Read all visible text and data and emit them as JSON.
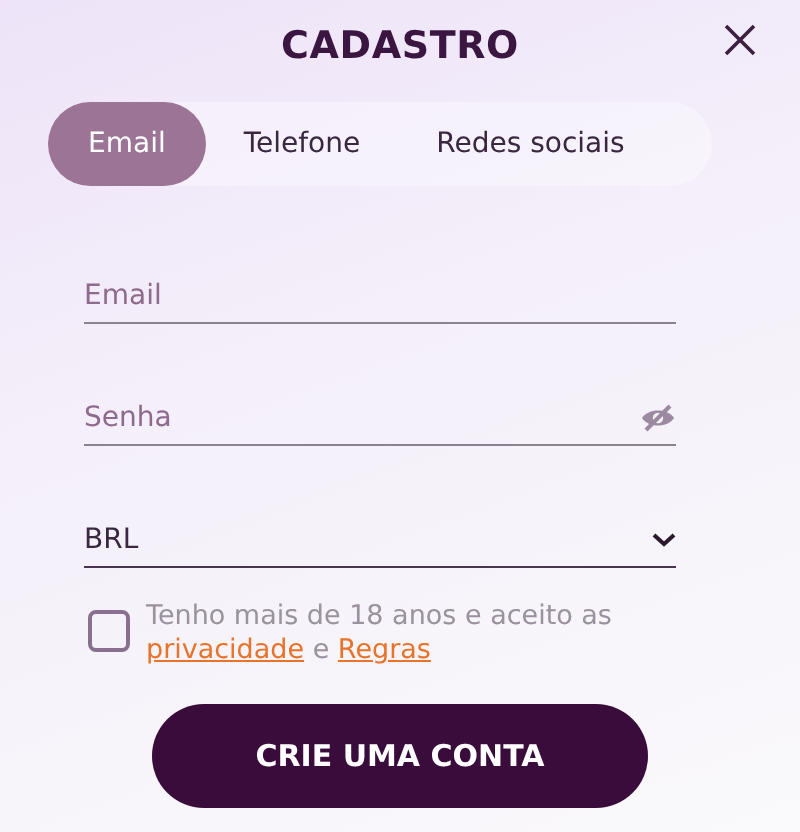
{
  "title": "CADASTRO",
  "tabs": [
    {
      "label": "Email",
      "selected": true
    },
    {
      "label": "Telefone",
      "selected": false
    },
    {
      "label": "Redes sociais",
      "selected": false
    }
  ],
  "fields": [
    {
      "kind": "text",
      "placeholder": "Email"
    },
    {
      "kind": "password",
      "placeholder": "Senha"
    },
    {
      "kind": "select",
      "value": "BRL"
    }
  ],
  "terms": {
    "checked": false,
    "text": "Tenho mais de 18 anos e aceito as",
    "links": [
      "privacidade",
      "Regras"
    ],
    "joiner": "e"
  },
  "submit": "CRIE UMA CONTA"
}
